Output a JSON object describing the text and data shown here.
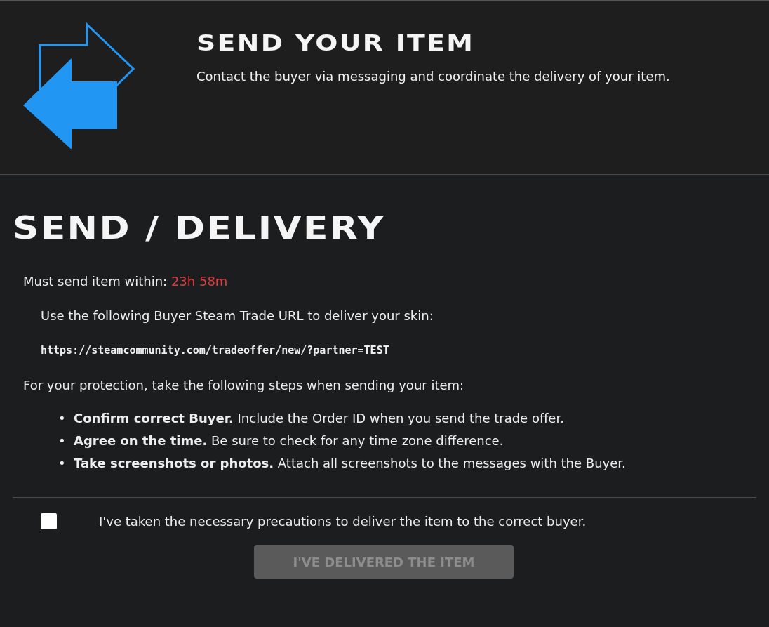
{
  "header": {
    "title": "SEND YOUR ITEM",
    "description": "Contact the buyer via messaging and coordinate the delivery of your item."
  },
  "section": {
    "title": "SEND / DELIVERY",
    "deadline": {
      "label": "Must send item within:",
      "value": "23h 58m"
    },
    "url_intro": "Use the following Buyer Steam Trade URL to deliver your skin:",
    "url": "https://steamcommunity.com/tradeoffer/new/?partner=TEST",
    "steps_intro": "For your protection, take the following steps when sending your item:",
    "steps": [
      {
        "marker": "•",
        "text": "**Confirm correct Buyer.** Include the Order ID when you send the trade offer."
      },
      {
        "marker": "•",
        "text": "**Agree on the time.** Be sure to check for any time zone difference."
      },
      {
        "marker": "•",
        "text": "**Take screenshots or photos.** Attach all screenshots to the messages with the Buyer."
      }
    ]
  },
  "confirmation": {
    "label": "I've taken the necessary precautions to deliver the item to the correct buyer.",
    "checked": false
  },
  "submit": {
    "label": "I'VE DELIVERED THE ITEM",
    "disabled": true
  }
}
